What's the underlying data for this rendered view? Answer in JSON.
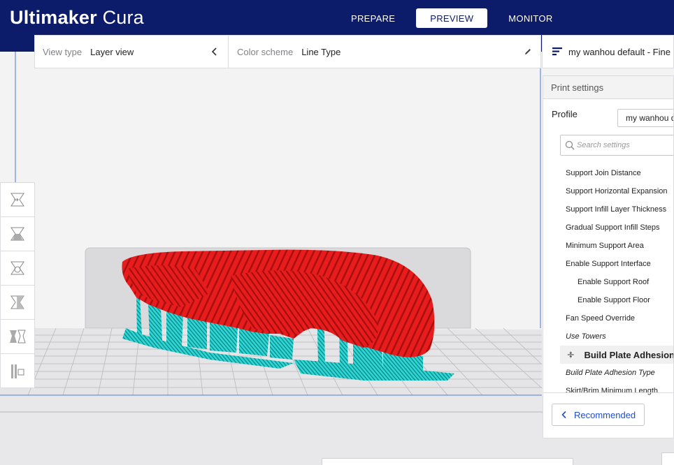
{
  "app": {
    "brand_bold": "Ultimaker",
    "brand_light": "Cura"
  },
  "stages": [
    {
      "label": "PREPARE",
      "active": false
    },
    {
      "label": "PREVIEW",
      "active": true
    },
    {
      "label": "MONITOR",
      "active": false
    }
  ],
  "view_bar": {
    "view_type_label": "View type",
    "view_type_value": "Layer view",
    "color_scheme_label": "Color scheme",
    "color_scheme_value": "Line Type"
  },
  "printer": {
    "name": "my wanhou default - Fine"
  },
  "toolbar": {
    "icons": [
      "move-icon",
      "scale-icon",
      "rotate-icon",
      "mirror-icon",
      "per-model-settings-icon",
      "support-blocker-icon"
    ]
  },
  "print_settings": {
    "title": "Print settings",
    "profile_label": "Profile",
    "profile_value": "my wanhou default",
    "search_placeholder": "Search settings",
    "items": [
      {
        "label": "Support Join Distance",
        "indent": false,
        "italic": false
      },
      {
        "label": "Support Horizontal Expansion",
        "indent": false,
        "italic": false
      },
      {
        "label": "Support Infill Layer Thickness",
        "indent": false,
        "italic": false
      },
      {
        "label": "Gradual Support Infill Steps",
        "indent": false,
        "italic": false
      },
      {
        "label": "Minimum Support Area",
        "indent": false,
        "italic": false
      },
      {
        "label": "Enable Support Interface",
        "indent": false,
        "italic": false
      },
      {
        "label": "Enable Support Roof",
        "indent": true,
        "italic": false
      },
      {
        "label": "Enable Support Floor",
        "indent": true,
        "italic": false
      },
      {
        "label": "Fan Speed Override",
        "indent": false,
        "italic": false
      },
      {
        "label": "Use Towers",
        "indent": false,
        "italic": true
      }
    ],
    "category": "Build Plate Adhesion",
    "items_after": [
      {
        "label": "Build Plate Adhesion Type",
        "indent": false,
        "italic": true
      },
      {
        "label": "Skirt/Brim Minimum Length",
        "indent": false,
        "italic": false
      }
    ],
    "recommended_button": "Recommended"
  },
  "colors": {
    "header": "#0d1b6b",
    "model_red": "#e81c1c",
    "support_cyan": "#2fd8d6",
    "accent_blue": "#1f4ec9"
  }
}
